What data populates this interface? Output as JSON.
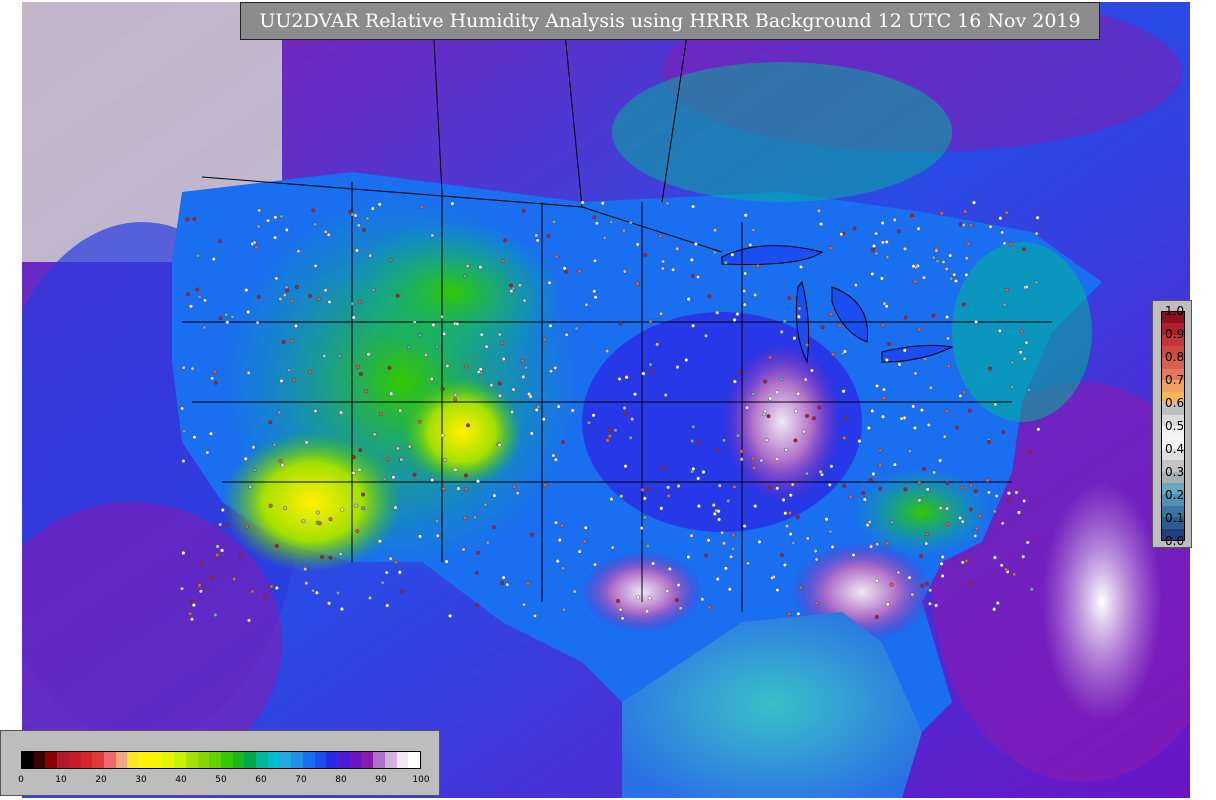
{
  "title": "UU2DVAR Relative Humidity Analysis using HRRR Background 12 UTC 16 Nov 2019",
  "rh_colorbar": {
    "ticks": [
      "0",
      "10",
      "20",
      "30",
      "40",
      "50",
      "60",
      "70",
      "80",
      "90",
      "100"
    ],
    "colors": [
      "#000000",
      "#3a0000",
      "#8b0000",
      "#b2182b",
      "#c41e2a",
      "#d6262b",
      "#e03a3a",
      "#ef6a6a",
      "#f4a582",
      "#fde725",
      "#fff200",
      "#f5f500",
      "#e8f500",
      "#c8f000",
      "#a6e000",
      "#8ad400",
      "#5fd400",
      "#33c800",
      "#1ab81a",
      "#00a84a",
      "#00b894",
      "#00bcd4",
      "#20a8e0",
      "#2090e8",
      "#1a6ef0",
      "#1a4ef2",
      "#2a2ae6",
      "#4a1ad6",
      "#6a14c4",
      "#8a1ab0",
      "#b070c8",
      "#d4b0e0",
      "#f0e8f4",
      "#ffffff"
    ]
  },
  "obs_colorbar": {
    "ticks": [
      "0.0",
      "0.1",
      "0.2",
      "0.3",
      "0.4",
      "0.5",
      "0.6",
      "0.7",
      "0.8",
      "0.9",
      "1.0"
    ],
    "colors": [
      "#1f3f7a",
      "#2b5b8f",
      "#3b76a3",
      "#4f90b4",
      "#6aa8c0",
      "#a8b0b4",
      "#c4c4c4",
      "#dedede",
      "#f4f4f4",
      "#f2f2f2",
      "#d9d9d9",
      "#c0c0c0",
      "#f7b45a",
      "#f0a060",
      "#e07a5a",
      "#d8604e",
      "#cc4a44",
      "#c0343a",
      "#b01e30",
      "#8c0f1f"
    ]
  },
  "colors": {
    "land_moist": "#2e3cf0",
    "land_dry": "#fde725",
    "ocean": "#3aa0e8",
    "background": "#d0d0d0",
    "boundary": "#000000"
  }
}
